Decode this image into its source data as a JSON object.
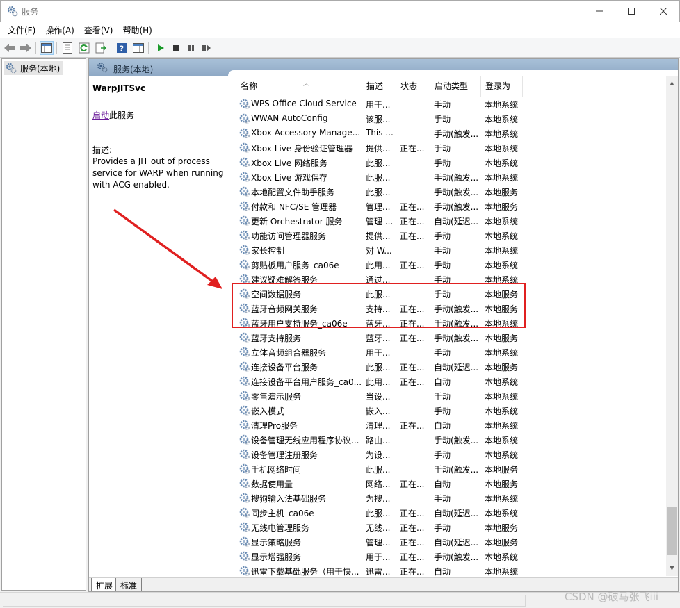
{
  "window": {
    "title": "服务"
  },
  "menu": [
    "文件(F)",
    "操作(A)",
    "查看(V)",
    "帮助(H)"
  ],
  "tree": {
    "item": "服务(本地)"
  },
  "pane": {
    "header": "服务(本地)"
  },
  "selected": {
    "name": "WarpJITSvc",
    "start_link": "启动",
    "start_suffix": "此服务",
    "desc_label": "描述:",
    "desc_text": "Provides a JIT out of process service for WARP when running with ACG enabled."
  },
  "columns": {
    "name": "名称",
    "desc": "描述",
    "status": "状态",
    "start": "启动类型",
    "logon": "登录为"
  },
  "services": [
    {
      "name": "WPS Office Cloud Service",
      "desc": "用于...",
      "status": "",
      "start": "手动",
      "logon": "本地系统"
    },
    {
      "name": "WWAN AutoConfig",
      "desc": "该服...",
      "status": "",
      "start": "手动",
      "logon": "本地系统"
    },
    {
      "name": "Xbox Accessory Manage...",
      "desc": "This ...",
      "status": "",
      "start": "手动(触发...",
      "logon": "本地系统"
    },
    {
      "name": "Xbox Live 身份验证管理器",
      "desc": "提供...",
      "status": "正在...",
      "start": "手动",
      "logon": "本地系统"
    },
    {
      "name": "Xbox Live 网络服务",
      "desc": "此服...",
      "status": "",
      "start": "手动",
      "logon": "本地系统"
    },
    {
      "name": "Xbox Live 游戏保存",
      "desc": "此服...",
      "status": "",
      "start": "手动(触发...",
      "logon": "本地系统"
    },
    {
      "name": "本地配置文件助手服务",
      "desc": "此服...",
      "status": "",
      "start": "手动(触发...",
      "logon": "本地服务"
    },
    {
      "name": "付款和 NFC/SE 管理器",
      "desc": "管理...",
      "status": "正在...",
      "start": "手动(触发...",
      "logon": "本地服务"
    },
    {
      "name": "更新 Orchestrator 服务",
      "desc": "管理 ...",
      "status": "正在...",
      "start": "自动(延迟...",
      "logon": "本地系统"
    },
    {
      "name": "功能访问管理器服务",
      "desc": "提供...",
      "status": "正在...",
      "start": "手动",
      "logon": "本地系统"
    },
    {
      "name": "家长控制",
      "desc": "对 W...",
      "status": "",
      "start": "手动",
      "logon": "本地系统"
    },
    {
      "name": "剪贴板用户服务_ca06e",
      "desc": "此用...",
      "status": "正在...",
      "start": "手动",
      "logon": "本地系统"
    },
    {
      "name": "建议疑难解答服务",
      "desc": "通过...",
      "status": "",
      "start": "手动",
      "logon": "本地系统"
    },
    {
      "name": "空间数据服务",
      "desc": "此服...",
      "status": "",
      "start": "手动",
      "logon": "本地服务"
    },
    {
      "name": "蓝牙音频网关服务",
      "desc": "支持...",
      "status": "正在...",
      "start": "手动(触发...",
      "logon": "本地服务"
    },
    {
      "name": "蓝牙用户支持服务_ca06e",
      "desc": "蓝牙...",
      "status": "正在...",
      "start": "手动(触发...",
      "logon": "本地系统"
    },
    {
      "name": "蓝牙支持服务",
      "desc": "蓝牙...",
      "status": "正在...",
      "start": "手动(触发...",
      "logon": "本地服务"
    },
    {
      "name": "立体音频组合器服务",
      "desc": "用于...",
      "status": "",
      "start": "手动",
      "logon": "本地系统"
    },
    {
      "name": "连接设备平台服务",
      "desc": "此服...",
      "status": "正在...",
      "start": "自动(延迟...",
      "logon": "本地服务"
    },
    {
      "name": "连接设备平台用户服务_ca0...",
      "desc": "此用...",
      "status": "正在...",
      "start": "自动",
      "logon": "本地系统"
    },
    {
      "name": "零售演示服务",
      "desc": "当设...",
      "status": "",
      "start": "手动",
      "logon": "本地系统"
    },
    {
      "name": "嵌入模式",
      "desc": "嵌入...",
      "status": "",
      "start": "手动",
      "logon": "本地系统"
    },
    {
      "name": "清理Pro服务",
      "desc": "清理...",
      "status": "正在...",
      "start": "自动",
      "logon": "本地系统"
    },
    {
      "name": "设备管理无线应用程序协议...",
      "desc": "路由...",
      "status": "",
      "start": "手动(触发...",
      "logon": "本地系统"
    },
    {
      "name": "设备管理注册服务",
      "desc": "为设...",
      "status": "",
      "start": "手动",
      "logon": "本地系统"
    },
    {
      "name": "手机网络时间",
      "desc": "此服...",
      "status": "",
      "start": "手动(触发...",
      "logon": "本地服务"
    },
    {
      "name": "数据使用量",
      "desc": "网络...",
      "status": "正在...",
      "start": "自动",
      "logon": "本地服务"
    },
    {
      "name": "搜狗输入法基础服务",
      "desc": "为搜...",
      "status": "",
      "start": "手动",
      "logon": "本地系统"
    },
    {
      "name": "同步主机_ca06e",
      "desc": "此服...",
      "status": "正在...",
      "start": "自动(延迟...",
      "logon": "本地系统"
    },
    {
      "name": "无线电管理服务",
      "desc": "无线...",
      "status": "正在...",
      "start": "手动",
      "logon": "本地服务"
    },
    {
      "name": "显示策略服务",
      "desc": "管理...",
      "status": "正在...",
      "start": "自动(延迟...",
      "logon": "本地服务"
    },
    {
      "name": "显示增强服务",
      "desc": "用于...",
      "status": "正在...",
      "start": "手动(触发...",
      "logon": "本地系统"
    },
    {
      "name": "迅雷下载基础服务（用于快...",
      "desc": "迅雷...",
      "status": "正在...",
      "start": "自动",
      "logon": "本地系统"
    }
  ],
  "tabs": [
    "扩展",
    "标准"
  ],
  "watermark": "CSDN @破马张飞iii",
  "colors": {
    "highlight": "#e02020",
    "header": "#9bb4ce"
  }
}
